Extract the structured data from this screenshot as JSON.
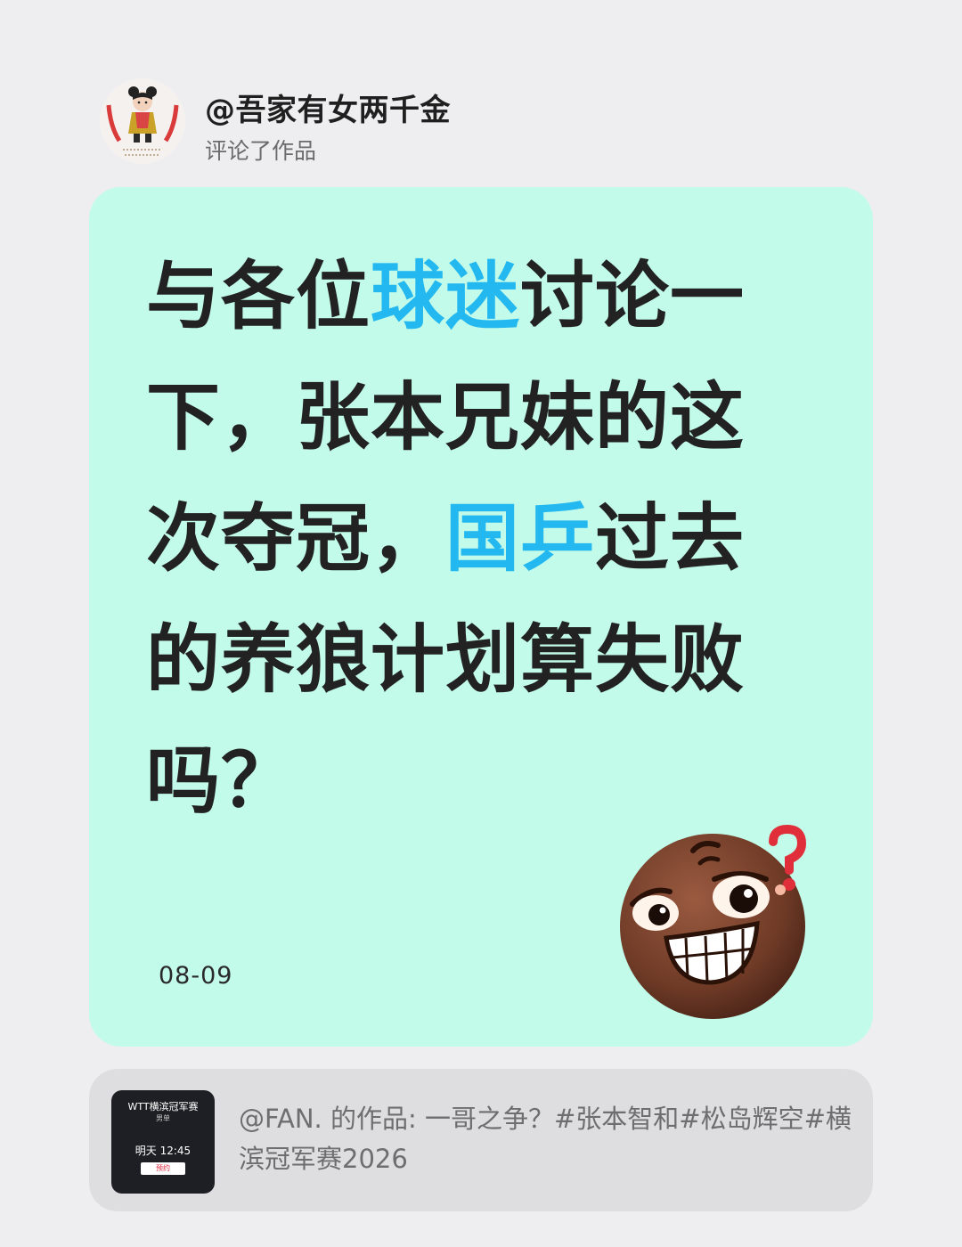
{
  "header": {
    "username": "@吾家有女两千金",
    "action": "评论了作品",
    "avatar_icon": "girl-illustration-avatar"
  },
  "card": {
    "headline_segments": [
      {
        "text": "与各位",
        "highlight": false
      },
      {
        "text": "球迷",
        "highlight": true
      },
      {
        "text": "讨论一下，张本兄妹的这次夺冠，",
        "highlight": false
      },
      {
        "text": "国乒",
        "highlight": true
      },
      {
        "text": "过去的养狼计划算失败吗？",
        "highlight": false
      }
    ],
    "date": "08-09",
    "emoji_icon": "smirking-question-face-emoji",
    "background": "#c2fbe9",
    "highlight_color": "#23b8f0"
  },
  "linked_post": {
    "thumbnail": {
      "title": "WTT横滨冠军赛",
      "subtitle": "男单",
      "time": "明天 12:45",
      "button": "预约"
    },
    "text": "@FAN. 的作品: 一哥之争？#张本智和#松岛辉空#横滨冠军赛2026"
  }
}
